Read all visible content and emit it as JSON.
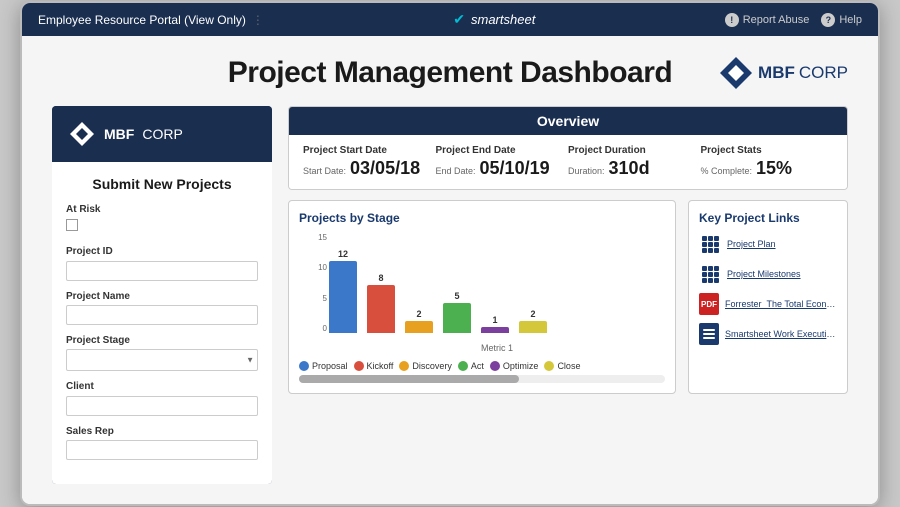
{
  "nav": {
    "portal_label": "Employee Resource Portal (View Only)",
    "brand": "smartsheet",
    "report_abuse": "Report Abuse",
    "help": "Help"
  },
  "dashboard": {
    "title": "Project Management Dashboard",
    "logo": {
      "mbf": "MBF",
      "corp": "CORP"
    }
  },
  "left_panel": {
    "logo": {
      "mbf": "MBF",
      "corp": "CORP"
    },
    "form_title": "Submit New Projects",
    "fields": [
      {
        "label": "At Risk",
        "type": "checkbox"
      },
      {
        "label": "Project ID",
        "type": "text"
      },
      {
        "label": "Project Name",
        "type": "text"
      },
      {
        "label": "Project Stage",
        "type": "select"
      },
      {
        "label": "Client",
        "type": "text"
      },
      {
        "label": "Sales Rep",
        "type": "text"
      }
    ]
  },
  "overview": {
    "header": "Overview",
    "stats": [
      {
        "label": "Project Start Date",
        "sub_label": "Start Date:",
        "value": "03/05/18"
      },
      {
        "label": "Project End Date",
        "sub_label": "End Date:",
        "value": "05/10/19"
      },
      {
        "label": "Project Duration",
        "sub_label": "Duration:",
        "value": "310d"
      },
      {
        "label": "Project Stats",
        "sub_label": "% Complete:",
        "value": "15%"
      }
    ]
  },
  "chart": {
    "title": "Projects by Stage",
    "x_axis_label": "Metric 1",
    "y_labels": [
      "15",
      "10",
      "5",
      "0"
    ],
    "bars": [
      {
        "label": "Proposal",
        "value": 12,
        "color": "#3b78c9",
        "height_pct": 80
      },
      {
        "label": "Kickoff",
        "value": 8,
        "color": "#d94f3d",
        "height_pct": 53
      },
      {
        "label": "Discovery",
        "value": 2,
        "color": "#e8a020",
        "height_pct": 13
      },
      {
        "label": "Act",
        "value": 5,
        "color": "#4caf50",
        "height_pct": 33
      },
      {
        "label": "Optimize",
        "value": 1,
        "color": "#7b3f9e",
        "height_pct": 7
      },
      {
        "label": "Close",
        "value": 2,
        "color": "#d4c83a",
        "height_pct": 13
      }
    ]
  },
  "key_links": {
    "title": "Key Project Links",
    "links": [
      {
        "text": "Project Plan",
        "icon": "grid"
      },
      {
        "text": "Project Milestones",
        "icon": "grid"
      },
      {
        "text": "Forrester_The Total Economic Impa...",
        "icon": "pdf"
      },
      {
        "text": "Smartsheet Work Execution Platfor...",
        "icon": "sheet"
      }
    ]
  }
}
